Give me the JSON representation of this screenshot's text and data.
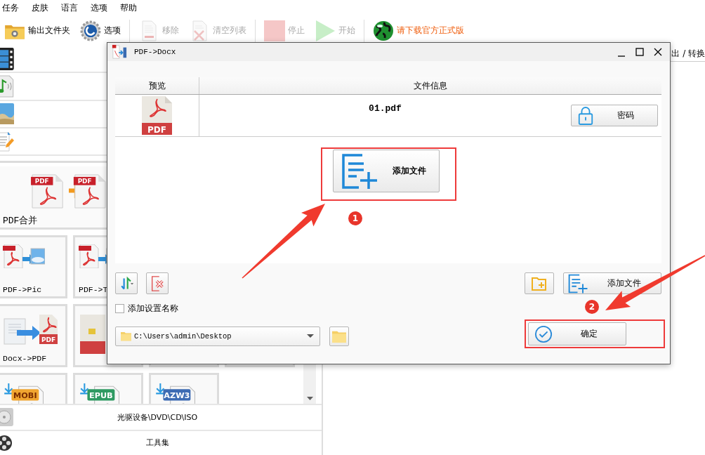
{
  "menu": [
    {
      "label": "任务"
    },
    {
      "label": "皮肤"
    },
    {
      "label": "语言"
    },
    {
      "label": "选项"
    },
    {
      "label": "帮助"
    }
  ],
  "toolbar": [
    {
      "items": [
        {
          "kind": "button",
          "label": "输出文件夹",
          "disabled": false
        },
        {
          "kind": "button",
          "label": "选项",
          "disabled": false
        }
      ]
    },
    {
      "items": [
        {
          "kind": "button",
          "label": "移除",
          "disabled": true
        },
        {
          "kind": "button",
          "label": "清空列表",
          "disabled": true
        }
      ]
    },
    {
      "items": [
        {
          "kind": "button",
          "label": "停止",
          "disabled": true
        },
        {
          "kind": "button",
          "label": "开始",
          "disabled": true
        }
      ]
    },
    {
      "items": [
        {
          "kind": "link",
          "label": "请下载官方正式版",
          "disabled": false
        }
      ]
    }
  ],
  "tiles": [
    {
      "kind": "wide",
      "icon_texts": [
        "PDF",
        "PDF"
      ],
      "label": "PDF合并"
    },
    {
      "kind": "tile",
      "label": "PDF->Pic"
    },
    {
      "kind": "tile",
      "label": "PDF->T"
    },
    {
      "kind": "tile",
      "icon_texts": [
        "PDF"
      ],
      "label": "Docx->PDF"
    },
    {
      "kind": "tile"
    },
    {
      "kind": "tile"
    },
    {
      "kind": "tile"
    },
    {
      "kind": "tile",
      "icon_texts": [
        "MOBI"
      ],
      "color": "#f0a530"
    },
    {
      "kind": "tile",
      "icon_texts": [
        "EPUB"
      ],
      "color": "#2f9a62"
    },
    {
      "kind": "tile",
      "icon_texts": [
        "AZW3"
      ],
      "color": "#3d6bb3"
    }
  ],
  "bottom_rows": [
    {
      "label": "光驱设备\\DVD\\CD\\ISO"
    },
    {
      "label": "工具集"
    }
  ],
  "right_panel": {
    "header": "出 / 转换"
  },
  "dialog": {
    "title": "PDF->Docx",
    "columns": [
      "预览",
      "文件信息"
    ],
    "files": [
      {
        "preview_text": "PDF",
        "name": "01.pdf",
        "button": "密码"
      }
    ],
    "add_button": "添加文件",
    "add_button_small": "添加文件",
    "checkbox": {
      "label": "添加设置名称",
      "checked": false
    },
    "path": {
      "value": "C:\\Users\\admin\\Desktop"
    },
    "ok_button": "确定"
  },
  "annotations": [
    {
      "number": "1"
    },
    {
      "number": "2"
    }
  ]
}
